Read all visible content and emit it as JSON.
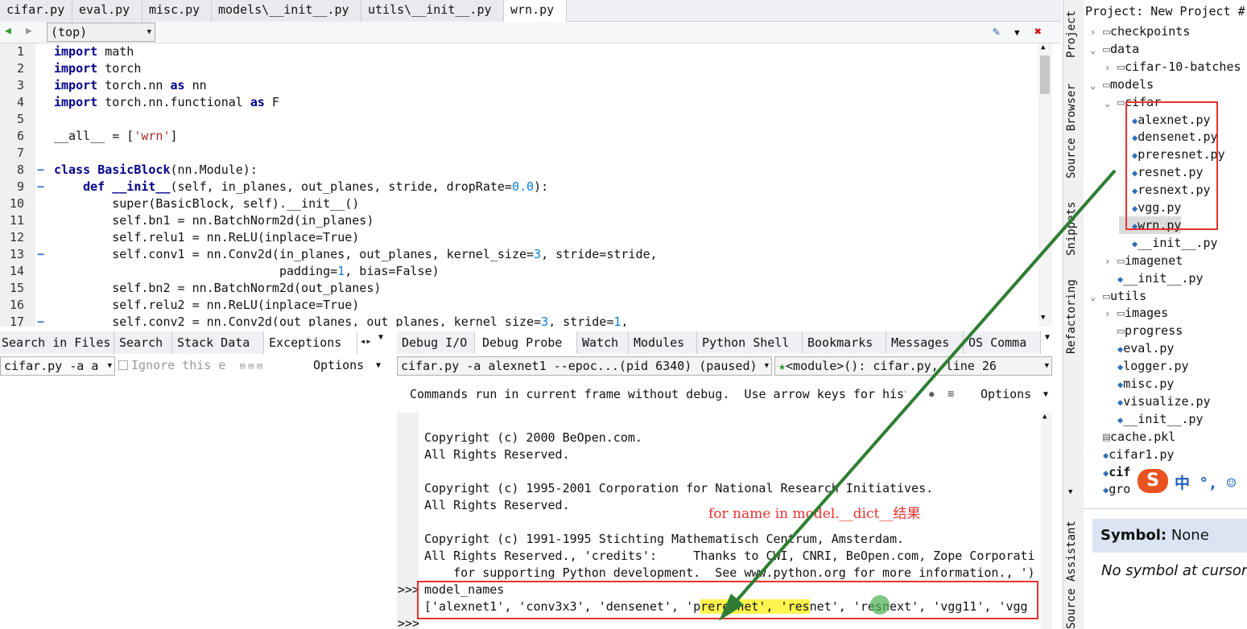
{
  "file_tabs": [
    "cifar.py",
    "eval.py",
    "misc.py",
    "models\\__init__.py",
    "utils\\__init__.py",
    "wrn.py"
  ],
  "scope": "(top)",
  "code_lines": [
    {
      "n": "1",
      "fold": "",
      "html": "<span class='kw'>import</span> math"
    },
    {
      "n": "2",
      "fold": "",
      "html": "<span class='kw'>import</span> torch"
    },
    {
      "n": "3",
      "fold": "",
      "html": "<span class='kw'>import</span> torch.nn <span class='kw'>as</span> nn"
    },
    {
      "n": "4",
      "fold": "",
      "html": "<span class='kw'>import</span> torch.nn.functional <span class='kw'>as</span> F"
    },
    {
      "n": "5",
      "fold": "",
      "html": ""
    },
    {
      "n": "6",
      "fold": "",
      "html": "__all__ = [<span class='str'>'wrn'</span>]"
    },
    {
      "n": "7",
      "fold": "",
      "html": ""
    },
    {
      "n": "8",
      "fold": "−",
      "html": "<span class='kw'>class</span> <span class='kw'>BasicBlock</span>(nn.Module):"
    },
    {
      "n": "9",
      "fold": "−",
      "html": "    <span class='kw'>def</span> <span class='kw'>__init__</span>(self, in_planes, out_planes, stride, dropRate=<span class='num'>0.0</span>):"
    },
    {
      "n": "10",
      "fold": "",
      "html": "        super(BasicBlock, self).__init__()"
    },
    {
      "n": "11",
      "fold": "",
      "html": "        self.bn1 = nn.BatchNorm2d(in_planes)"
    },
    {
      "n": "12",
      "fold": "",
      "html": "        self.relu1 = nn.ReLU(inplace=True)"
    },
    {
      "n": "13",
      "fold": "−",
      "html": "        self.conv1 = nn.Conv2d(in_planes, out_planes, kernel_size=<span class='num'>3</span>, stride=stride,"
    },
    {
      "n": "14",
      "fold": "",
      "html": "                               padding=<span class='num'>1</span>, bias=False)"
    },
    {
      "n": "15",
      "fold": "",
      "html": "        self.bn2 = nn.BatchNorm2d(out_planes)"
    },
    {
      "n": "16",
      "fold": "",
      "html": "        self.relu2 = nn.ReLU(inplace=True)"
    },
    {
      "n": "17",
      "fold": "−",
      "html": "        self.conv2 = nn.Conv2d(out_planes, out_planes, kernel_size=<span class='num'>3</span>, stride=<span class='num'>1</span>,"
    }
  ],
  "left_tabs": [
    "Search in Files",
    "Search",
    "Stack Data",
    "Exceptions"
  ],
  "left_combo": "cifar.py -a a",
  "ignore_label": "Ignore this e",
  "options_label": "Options",
  "debug_tabs": [
    "Debug I/O",
    "Debug Probe",
    "Watch",
    "Modules",
    "Python Shell",
    "Bookmarks",
    "Messages",
    "OS Comma"
  ],
  "process_combo": "cifar.py -a alexnet1 --epoc...(pid 6340) (paused)",
  "frame_combo": "<module>(): cifar.py, line 26",
  "probe_hint": "Commands run in current frame without debug.  Use arrow keys for hist",
  "shell_lines": [
    "Copyright (c) 2000 BeOpen.com.",
    "All Rights Reserved.",
    "",
    "Copyright (c) 1995-2001 Corporation for National Research Initiatives.",
    "All Rights Reserved.",
    "",
    "Copyright (c) 1991-1995 Stichting Mathematisch Centrum, Amsterdam.",
    "All Rights Reserved., 'credits':     Thanks to CWI, CNRI, BeOpen.com, Zope Corporati",
    "    for supporting Python development.  See www.python.org for more information., ')"
  ],
  "prompt": ">>>",
  "command": "model_names",
  "result_html": "['alexnet1', 'conv3x3', 'densenet', 'p<span class='hl'>reresnet', 'res</span>net', 'resnext', 'vgg11', 'vgg",
  "annotation": "for name in model.__dict__结果",
  "vertical_tabs": [
    "Project",
    "Source Browser",
    "Snippets",
    "Refactoring",
    "Source Assistant"
  ],
  "project_title": "Project: New Project #",
  "tree": [
    {
      "label": "checkpoints",
      "depth": 0,
      "kind": "folder",
      "arrow": ">"
    },
    {
      "label": "data",
      "depth": 0,
      "kind": "folder",
      "arrow": "v"
    },
    {
      "label": "cifar-10-batches",
      "depth": 1,
      "kind": "folder",
      "arrow": ">"
    },
    {
      "label": "models",
      "depth": 0,
      "kind": "folder",
      "arrow": "v"
    },
    {
      "label": "cifar",
      "depth": 1,
      "kind": "folder",
      "arrow": "v"
    },
    {
      "label": "alexnet.py",
      "depth": 2,
      "kind": "py",
      "arrow": ""
    },
    {
      "label": "densenet.py",
      "depth": 2,
      "kind": "py",
      "arrow": ""
    },
    {
      "label": "preresnet.py",
      "depth": 2,
      "kind": "py",
      "arrow": ""
    },
    {
      "label": "resnet.py",
      "depth": 2,
      "kind": "py",
      "arrow": ""
    },
    {
      "label": "resnext.py",
      "depth": 2,
      "kind": "py",
      "arrow": ""
    },
    {
      "label": "vgg.py",
      "depth": 2,
      "kind": "py",
      "arrow": ""
    },
    {
      "label": "wrn.py",
      "depth": 2,
      "kind": "py",
      "arrow": ""
    },
    {
      "label": "__init__.py",
      "depth": 2,
      "kind": "py",
      "arrow": ""
    },
    {
      "label": "imagenet",
      "depth": 1,
      "kind": "folder",
      "arrow": ">"
    },
    {
      "label": "__init__.py",
      "depth": 1,
      "kind": "py",
      "arrow": ""
    },
    {
      "label": "utils",
      "depth": 0,
      "kind": "folder",
      "arrow": "v"
    },
    {
      "label": "images",
      "depth": 1,
      "kind": "folder",
      "arrow": ">"
    },
    {
      "label": "progress",
      "depth": 1,
      "kind": "folder",
      "arrow": ""
    },
    {
      "label": "eval.py",
      "depth": 1,
      "kind": "py",
      "arrow": ""
    },
    {
      "label": "logger.py",
      "depth": 1,
      "kind": "py",
      "arrow": ""
    },
    {
      "label": "misc.py",
      "depth": 1,
      "kind": "py",
      "arrow": ""
    },
    {
      "label": "visualize.py",
      "depth": 1,
      "kind": "py",
      "arrow": ""
    },
    {
      "label": "__init__.py",
      "depth": 1,
      "kind": "py",
      "arrow": ""
    },
    {
      "label": "cache.pkl",
      "depth": 0,
      "kind": "file",
      "arrow": ""
    },
    {
      "label": "cifar1.py",
      "depth": 0,
      "kind": "py",
      "arrow": ""
    },
    {
      "label": "cif",
      "depth": 0,
      "kind": "py",
      "arrow": ""
    },
    {
      "label": "gro",
      "depth": 0,
      "kind": "py",
      "arrow": ""
    }
  ],
  "symbol_label": "Symbol:",
  "symbol_value": "None",
  "no_symbol": "No symbol at cursor",
  "ime_text": "中 °, ☺",
  "colors": {
    "annotation": "#e8322e",
    "arrow": "#2e7d32",
    "highlight": "#fff34d",
    "keyword": "#00008b"
  }
}
